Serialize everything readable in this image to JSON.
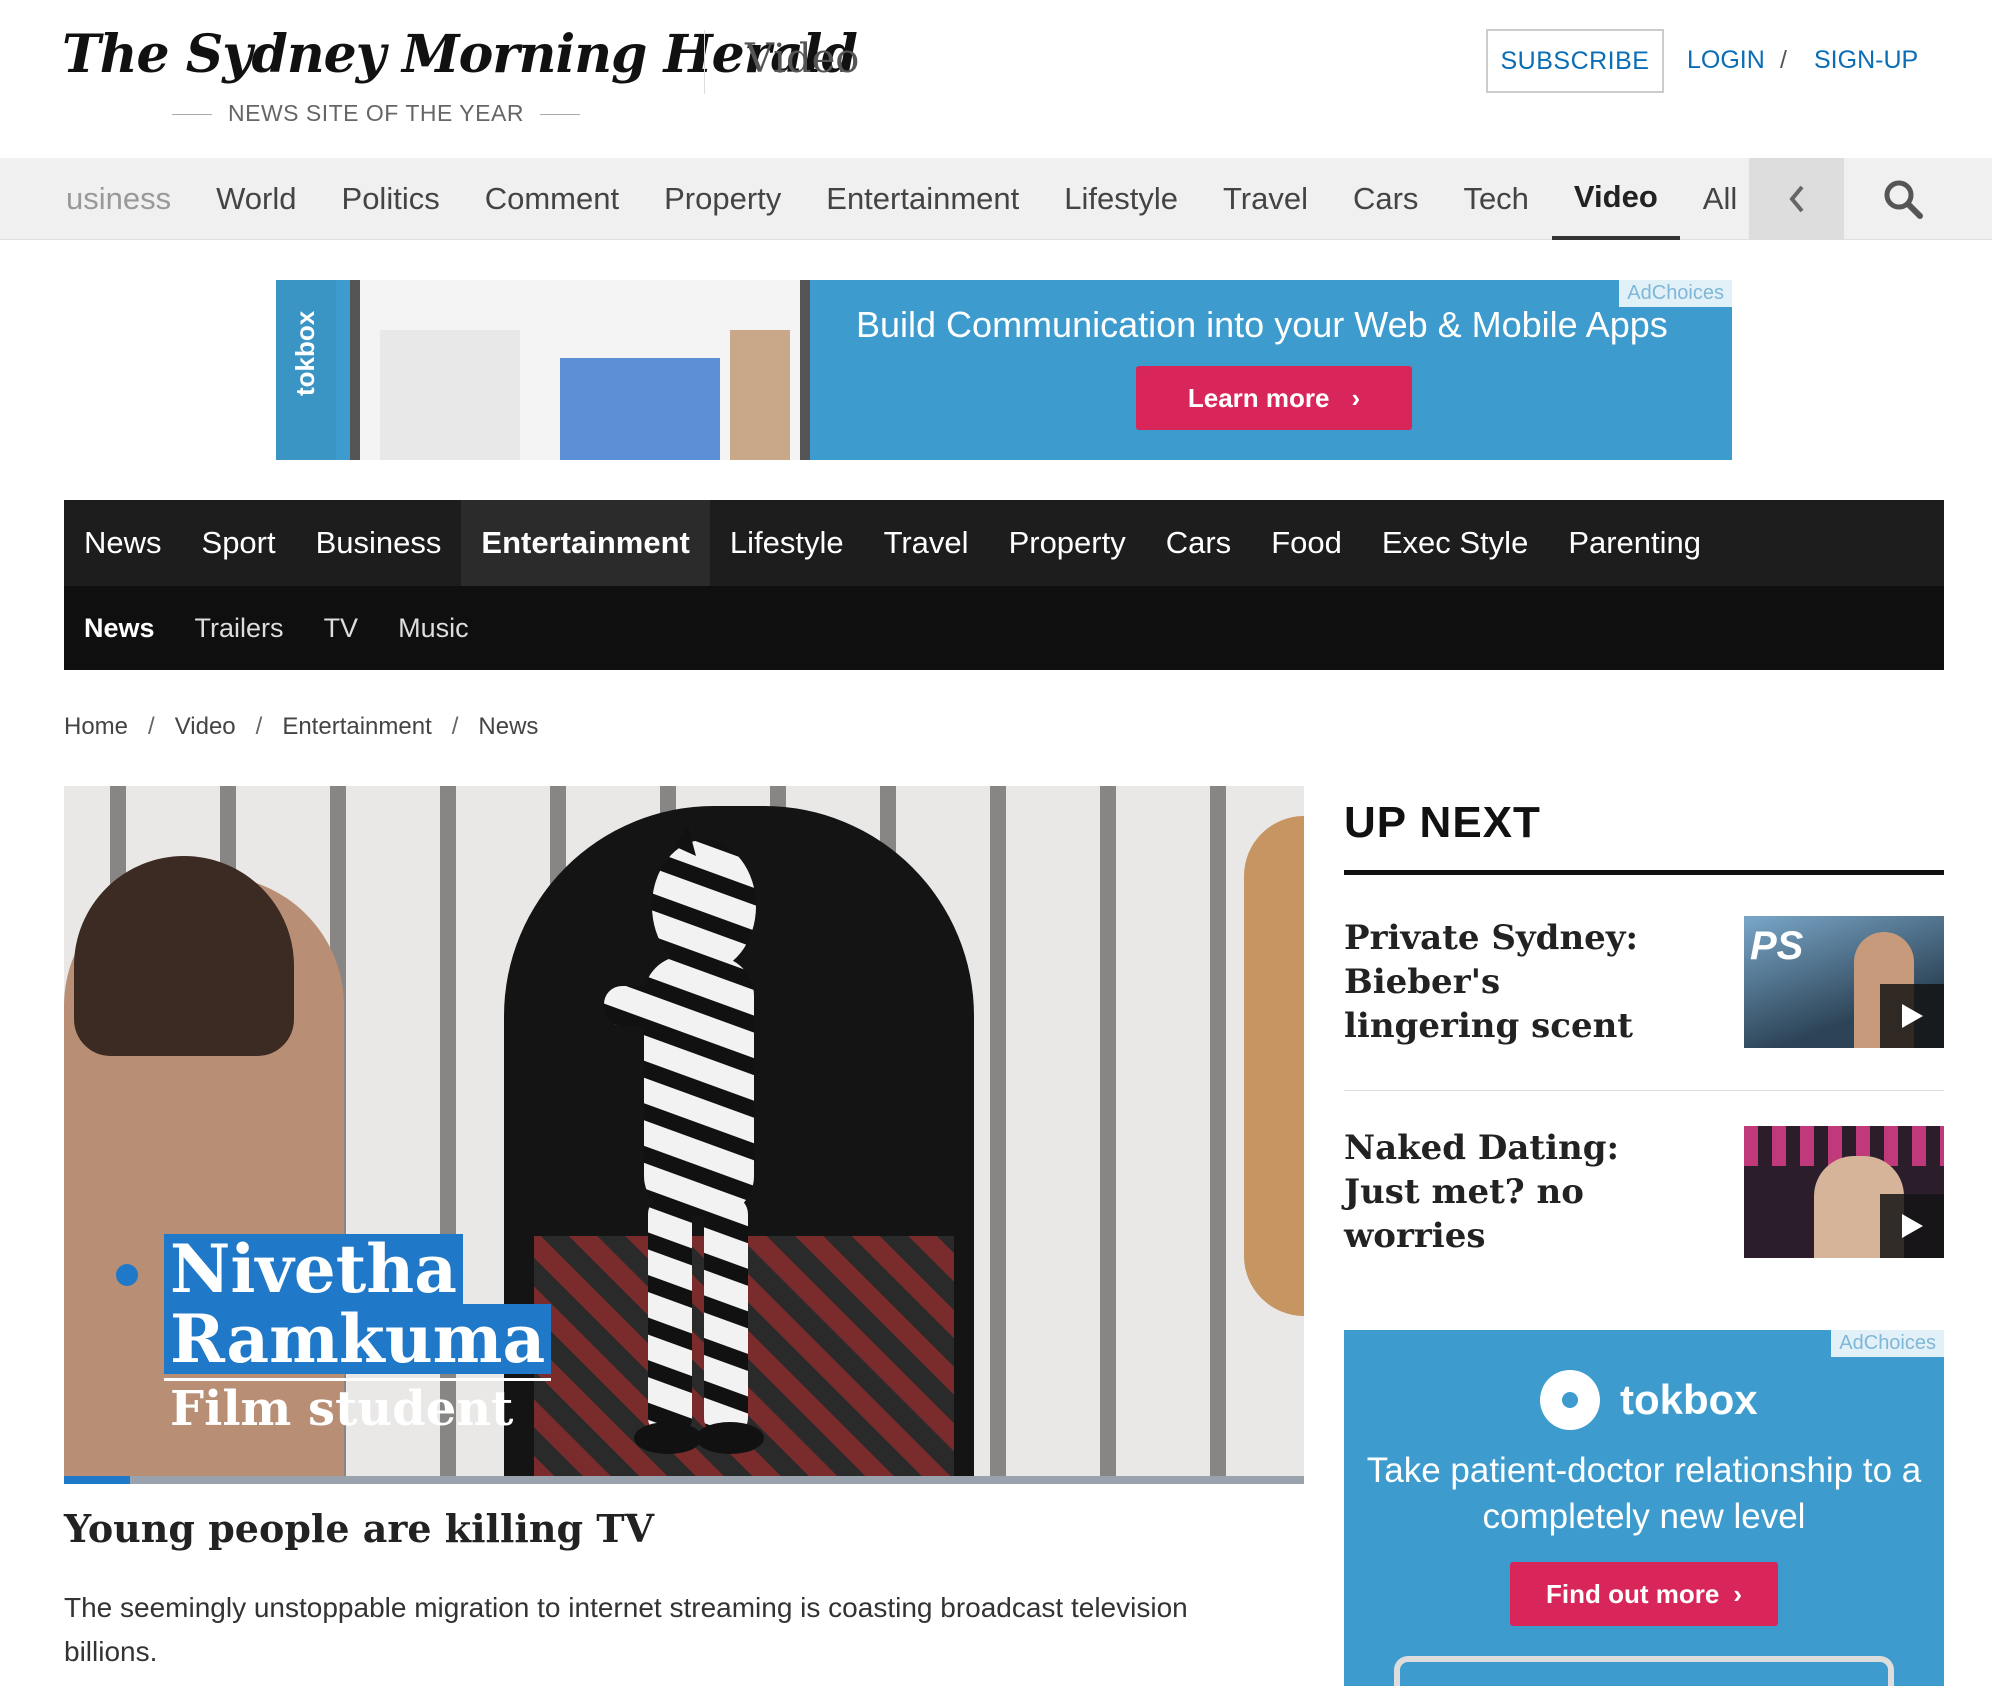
{
  "header": {
    "masthead": "The Sydney Morning Herald",
    "tagline": "NEWS SITE OF THE YEAR",
    "section_title": "Video",
    "subscribe_label": "SUBSCRIBE",
    "login_label": "LOGIN",
    "separator": "/",
    "signup_label": "SIGN-UP"
  },
  "top_nav": {
    "items": [
      "usiness",
      "World",
      "Politics",
      "Comment",
      "Property",
      "Entertainment",
      "Lifestyle",
      "Travel",
      "Cars",
      "Tech",
      "Video",
      "All"
    ],
    "active": "Video",
    "back_icon": "chevron-left-icon",
    "search_icon": "search-icon"
  },
  "ad_banner": {
    "brand": "tokbox",
    "headline": "Build Communication into your Web & Mobile Apps",
    "cta": "Learn more",
    "adchoices": "AdChoices"
  },
  "section_nav": {
    "primary": [
      "News",
      "Sport",
      "Business",
      "Entertainment",
      "Lifestyle",
      "Travel",
      "Property",
      "Cars",
      "Food",
      "Exec Style",
      "Parenting"
    ],
    "primary_active": "Entertainment",
    "secondary": [
      "News",
      "Trailers",
      "TV",
      "Music"
    ],
    "secondary_active": "News"
  },
  "breadcrumb": [
    "Home",
    "Video",
    "Entertainment",
    "News"
  ],
  "video": {
    "lower_third_name_1": "Nivetha",
    "lower_third_name_2": "Ramkuma",
    "lower_third_role": "Film student",
    "progress": 0.053,
    "title": "Young people are killing TV",
    "description": "The seemingly unstoppable migration to internet streaming is coasting broadcast television billions."
  },
  "up_next": {
    "heading": "UP NEXT",
    "items": [
      {
        "title": "Private Sydney: Bieber's lingering scent",
        "thumb_label": "PS",
        "play_icon": "play-icon"
      },
      {
        "title": "Naked Dating: Just met? no worries",
        "play_icon": "play-icon"
      }
    ]
  },
  "side_ad": {
    "brand": "tokbox",
    "copy": "Take patient-doctor relationship to a completely new level",
    "cta": "Find out more",
    "adchoices": "AdChoices"
  },
  "colors": {
    "link_blue": "#0a6db5",
    "ad_blue": "#3d9ccd",
    "ad_cta": "#d9265a",
    "nav_dark": "#1d1d1d",
    "lower_third_blue": "#1f78c8"
  }
}
